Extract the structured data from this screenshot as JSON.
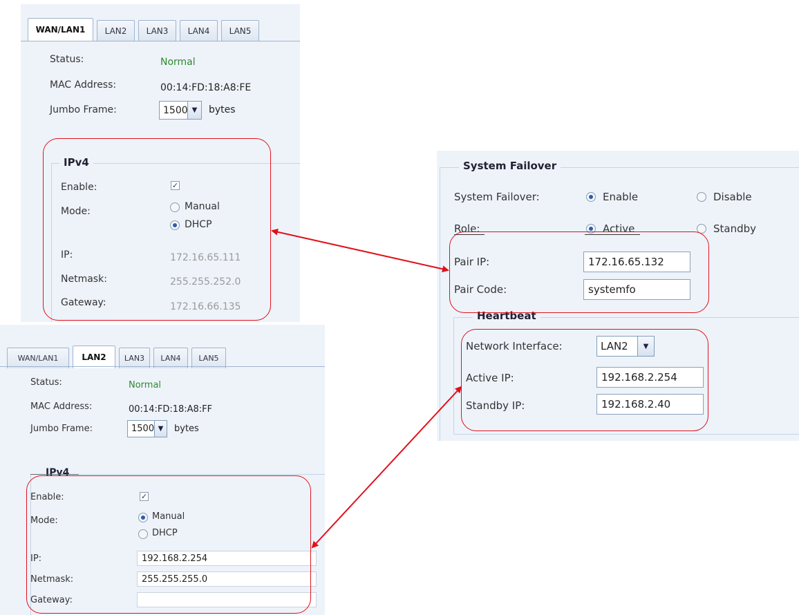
{
  "panel1": {
    "tabs": [
      "WAN/LAN1",
      "LAN2",
      "LAN3",
      "LAN4",
      "LAN5"
    ],
    "status_label": "Status:",
    "status_value": "Normal",
    "mac_label": "MAC Address:",
    "mac_value": "00:14:FD:18:A8:FE",
    "jumbo_label": "Jumbo Frame:",
    "jumbo_value": "1500",
    "jumbo_unit": "bytes",
    "ipv4_legend": "IPv4",
    "enable_label": "Enable:",
    "enable_checked": true,
    "mode_label": "Mode:",
    "mode_manual": "Manual",
    "mode_dhcp": "DHCP",
    "mode_selected": "DHCP",
    "ip_label": "IP:",
    "ip_value": "172.16.65.111",
    "netmask_label": "Netmask:",
    "netmask_value": "255.255.252.0",
    "gateway_label": "Gateway:",
    "gateway_value": "172.16.66.135"
  },
  "panel2": {
    "tabs": [
      "WAN/LAN1",
      "LAN2",
      "LAN3",
      "LAN4",
      "LAN5"
    ],
    "status_label": "Status:",
    "status_value": "Normal",
    "mac_label": "MAC Address:",
    "mac_value": "00:14:FD:18:A8:FF",
    "jumbo_label": "Jumbo Frame:",
    "jumbo_value": "1500",
    "jumbo_unit": "bytes",
    "ipv4_legend": "IPv4",
    "enable_label": "Enable:",
    "enable_checked": true,
    "mode_label": "Mode:",
    "mode_manual": "Manual",
    "mode_dhcp": "DHCP",
    "mode_selected": "Manual",
    "ip_label": "IP:",
    "ip_value": "192.168.2.254",
    "netmask_label": "Netmask:",
    "netmask_value": "255.255.255.0",
    "gateway_label": "Gateway:",
    "gateway_value": ""
  },
  "failover": {
    "legend": "System Failover",
    "sf_label": "System Failover:",
    "enable_label": "Enable",
    "disable_label": "Disable",
    "sf_selected": "Enable",
    "role_label": "Role:",
    "active_label": "Active",
    "standby_label": "Standby",
    "role_selected": "Active",
    "pair_ip_label": "Pair IP:",
    "pair_ip_value": "172.16.65.132",
    "pair_code_label": "Pair Code:",
    "pair_code_value": "systemfo",
    "heartbeat_legend": "Heartbeat",
    "net_if_label": "Network Interface:",
    "net_if_value": "LAN2",
    "active_ip_label": "Active IP:",
    "active_ip_value": "192.168.2.254",
    "standby_ip_label": "Standby IP:",
    "standby_ip_value": "192.168.2.40"
  },
  "annotation_color": "#e0101a"
}
